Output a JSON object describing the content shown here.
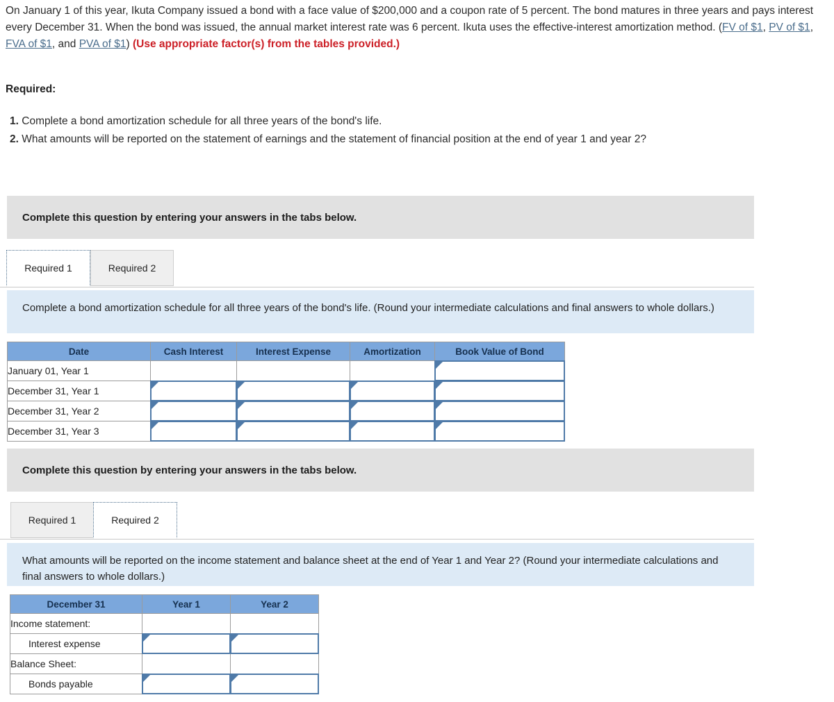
{
  "problem": {
    "paragraph_part1": "On January 1 of this year, Ikuta Company issued a bond with a face value of $200,000 and a coupon rate of 5 percent. The bond matures in three years and pays interest every December 31. When the bond was issued, the annual market interest rate was 6 percent. Ikuta uses the effective-interest amortization method. (",
    "link_fv": "FV of $1",
    "sep1": ", ",
    "link_pv": "PV of $1",
    "sep2": ", ",
    "link_fva": "FVA of $1",
    "sep3": ", and ",
    "link_pva": "PVA of $1",
    "close_paren": ") ",
    "use_factors_note": "(Use appropriate factor(s) from the tables provided.)"
  },
  "required": {
    "heading": "Required:",
    "items": [
      {
        "num": "1.",
        "text": "Complete a bond amortization schedule for all three years of the bond's life."
      },
      {
        "num": "2.",
        "text": "What amounts will be reported on the statement of earnings and the statement of financial position at the end of year 1 and year 2?"
      }
    ]
  },
  "panel1": {
    "header": "Complete this question by entering your answers in the tabs below.",
    "tabs": [
      {
        "label": "Required 1",
        "active": true
      },
      {
        "label": "Required 2",
        "active": false
      }
    ],
    "instruction": "Complete a bond amortization schedule for all three years of the bond's life. (Round your intermediate calculations and final answers to whole dollars.)",
    "table": {
      "headers": [
        "Date",
        "Cash Interest",
        "Interest Expense",
        "Amortization",
        "Book Value of Bond"
      ],
      "rows": [
        {
          "date": "January 01, Year 1",
          "cash_interest": "",
          "interest_expense": "",
          "amortization": "",
          "book_value": "",
          "inputs": [
            false,
            false,
            false,
            true
          ]
        },
        {
          "date": "December 31, Year 1",
          "cash_interest": "",
          "interest_expense": "",
          "amortization": "",
          "book_value": "",
          "inputs": [
            true,
            true,
            true,
            true
          ]
        },
        {
          "date": "December 31, Year 2",
          "cash_interest": "",
          "interest_expense": "",
          "amortization": "",
          "book_value": "",
          "inputs": [
            true,
            true,
            true,
            true
          ]
        },
        {
          "date": "December 31, Year 3",
          "cash_interest": "",
          "interest_expense": "",
          "amortization": "",
          "book_value": "",
          "inputs": [
            true,
            true,
            true,
            true
          ]
        }
      ]
    }
  },
  "panel2": {
    "header": "Complete this question by entering your answers in the tabs below.",
    "tabs": [
      {
        "label": "Required 1",
        "active": false
      },
      {
        "label": "Required 2",
        "active": true
      }
    ],
    "instruction": "What amounts will be reported on the income statement and balance sheet at the end of Year 1 and Year 2? (Round your intermediate calculations and final answers to whole dollars.)",
    "table": {
      "headers": [
        "December 31",
        "Year 1",
        "Year 2"
      ],
      "rows": [
        {
          "label": "Income statement:",
          "indent": false,
          "year1": "",
          "year2": "",
          "inputs": false
        },
        {
          "label": "Interest expense",
          "indent": true,
          "year1": "",
          "year2": "",
          "inputs": true
        },
        {
          "label": "Balance Sheet:",
          "indent": false,
          "year1": "",
          "year2": "",
          "inputs": false
        },
        {
          "label": "Bonds payable",
          "indent": true,
          "year1": "",
          "year2": "",
          "inputs": true
        }
      ]
    }
  },
  "colors": {
    "link": "#4a6d8c",
    "red_note": "#cc2027",
    "table_header": "#7ba7dc",
    "instruction_bg": "#ddeaf6",
    "panel_bg": "#e1e1e1",
    "input_border": "#4f7aa8"
  }
}
